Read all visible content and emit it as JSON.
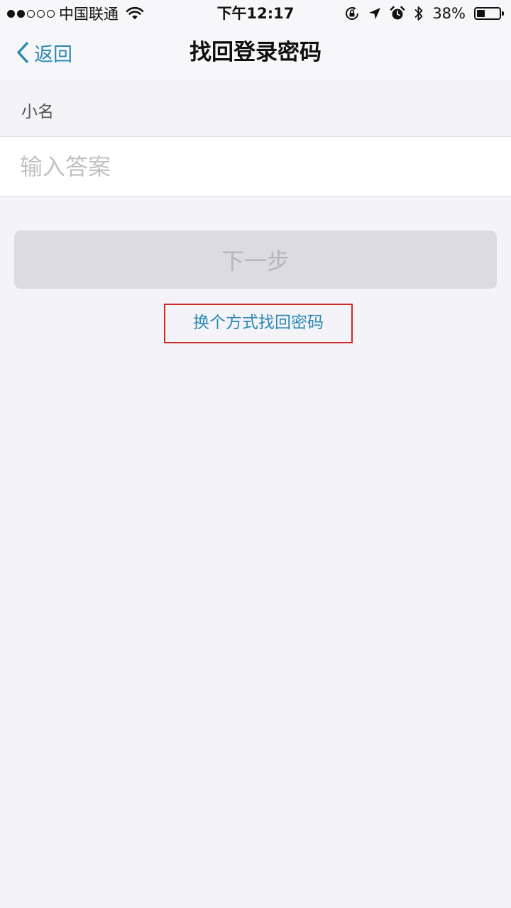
{
  "status_bar": {
    "carrier": "中国联通",
    "time": "下午12:17",
    "battery_percent": "38%",
    "battery_level": 0.38,
    "signal_bars": 2,
    "signal_total": 5,
    "icons": [
      "wifi-icon",
      "orientation-lock-icon",
      "location-arrow-icon",
      "alarm-icon",
      "bluetooth-icon",
      "battery-icon"
    ]
  },
  "nav": {
    "back_label": "返回",
    "title": "找回登录密码"
  },
  "form": {
    "question": "小名",
    "answer_value": "",
    "answer_placeholder": "输入答案",
    "next_label": "下一步"
  },
  "alternate": {
    "label": "换个方式找回密码"
  },
  "colors": {
    "accent": "#2a88b4",
    "highlight_border": "#cc2a2a",
    "background": "#f4f3f8",
    "button_disabled": "#dcdbe0"
  }
}
